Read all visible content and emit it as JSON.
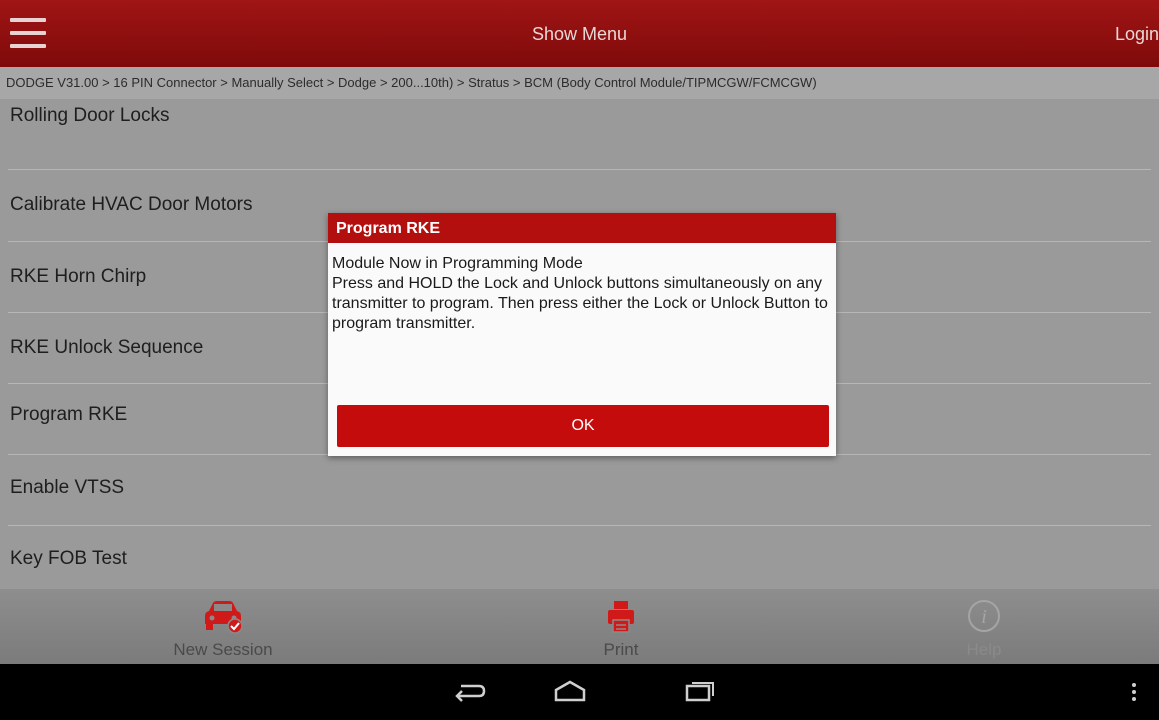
{
  "header": {
    "title": "Show Menu",
    "login_label": "Login"
  },
  "breadcrumb": "DODGE V31.00 > 16 PIN Connector > Manually Select > Dodge > 200...10th) > Stratus > BCM (Body Control Module/TIPMCGW/FCMCGW)",
  "functions": [
    "Rolling Door Locks",
    "Calibrate HVAC Door Motors",
    "RKE Horn Chirp",
    "RKE Unlock Sequence",
    "Program RKE",
    "Enable VTSS",
    "Key FOB Test"
  ],
  "dialog": {
    "title": "Program RKE",
    "message": "Module Now in Programming Mode\nPress and HOLD the Lock and Unlock buttons simultaneously on any transmitter to program. Then press either the Lock or Unlock Button to program transmitter.",
    "ok_label": "OK"
  },
  "toolbar": {
    "new_session_label": "New Session",
    "print_label": "Print",
    "help_label": "Help"
  },
  "colors": {
    "header_red": "#8f0f0f",
    "accent_red": "#c40c0c",
    "background_gray": "#9a9a9a"
  }
}
